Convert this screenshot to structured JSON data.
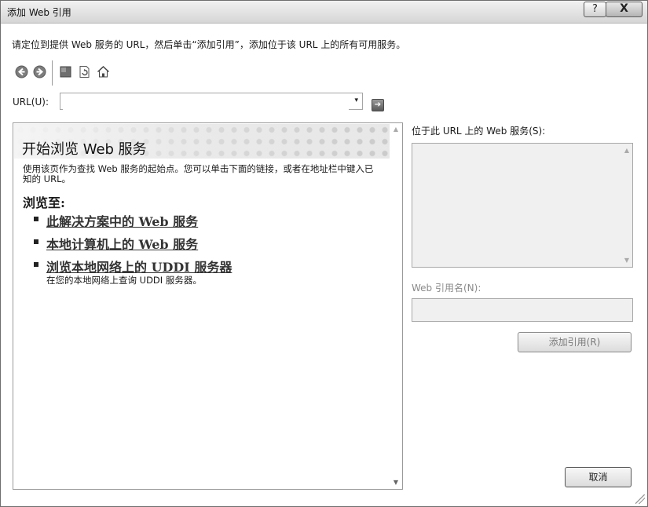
{
  "window": {
    "title": "添加 Web 引用",
    "help_label": "?",
    "close_label": "X"
  },
  "instruction": "请定位到提供 Web 服务的 URL，然后单击“添加引用”，添加位于该 URL 上的所有可用服务。",
  "toolbar": {
    "icons": [
      "back-icon",
      "forward-icon",
      "stop-icon",
      "refresh-icon",
      "home-icon"
    ]
  },
  "url": {
    "label": "URL(U):",
    "value": "",
    "dropdown_glyph": "▾",
    "go_glyph": "➔"
  },
  "browser": {
    "banner_title": "开始浏览 Web 服务",
    "intro": "使用该页作为查找 Web 服务的起始点。您可以单击下面的链接，或者在地址栏中键入已知的 URL。",
    "browse_heading": "浏览至:",
    "links": [
      {
        "label": "此解决方案中的 Web 服务"
      },
      {
        "label": "本地计算机上的 Web 服务"
      },
      {
        "label": "浏览本地网络上的 UDDI 服务器",
        "description": "在您的本地网络上查询 UDDI 服务器。"
      }
    ]
  },
  "services": {
    "label": "位于此 URL 上的 Web 服务(S):"
  },
  "reference": {
    "label": "Web 引用名(N):",
    "value": ""
  },
  "buttons": {
    "add_reference": "添加引用(R)",
    "cancel": "取消"
  },
  "colors": {
    "title_bar": "#dcdcdc",
    "disabled_text": "#8a8a8a",
    "panel_bg": "#f0f0f0"
  }
}
